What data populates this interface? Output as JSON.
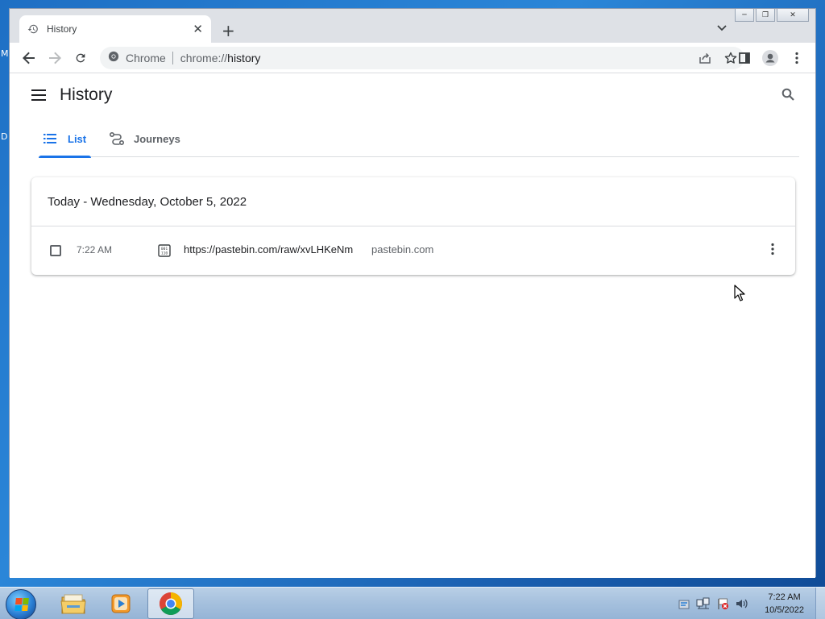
{
  "desktop": {
    "label_m": "M",
    "label_d": "D"
  },
  "window": {
    "minimize_glyph": "─",
    "restore_glyph": "❐",
    "close_glyph": "✕"
  },
  "tab": {
    "title": "History",
    "close_glyph": "✕"
  },
  "newtab_glyph": "+",
  "omnibox": {
    "site_label": "Chrome",
    "url_scheme": "chrome://",
    "url_host": "history"
  },
  "page": {
    "title": "History",
    "tabs": [
      {
        "label": "List",
        "active": true
      },
      {
        "label": "Journeys",
        "active": false
      }
    ],
    "section_date": "Today - Wednesday, October 5, 2022",
    "entries": [
      {
        "time": "7:22 AM",
        "title": "https://pastebin.com/raw/xvLHKeNm",
        "domain": "pastebin.com"
      }
    ]
  },
  "taskbar": {
    "apps": [
      "Windows Explorer",
      "Windows Media Player",
      "Google Chrome"
    ],
    "clock_time": "7:22 AM",
    "clock_date": "10/5/2022"
  },
  "colors": {
    "accent": "#1a73e8",
    "text": "#202124",
    "muted": "#5f6368"
  }
}
